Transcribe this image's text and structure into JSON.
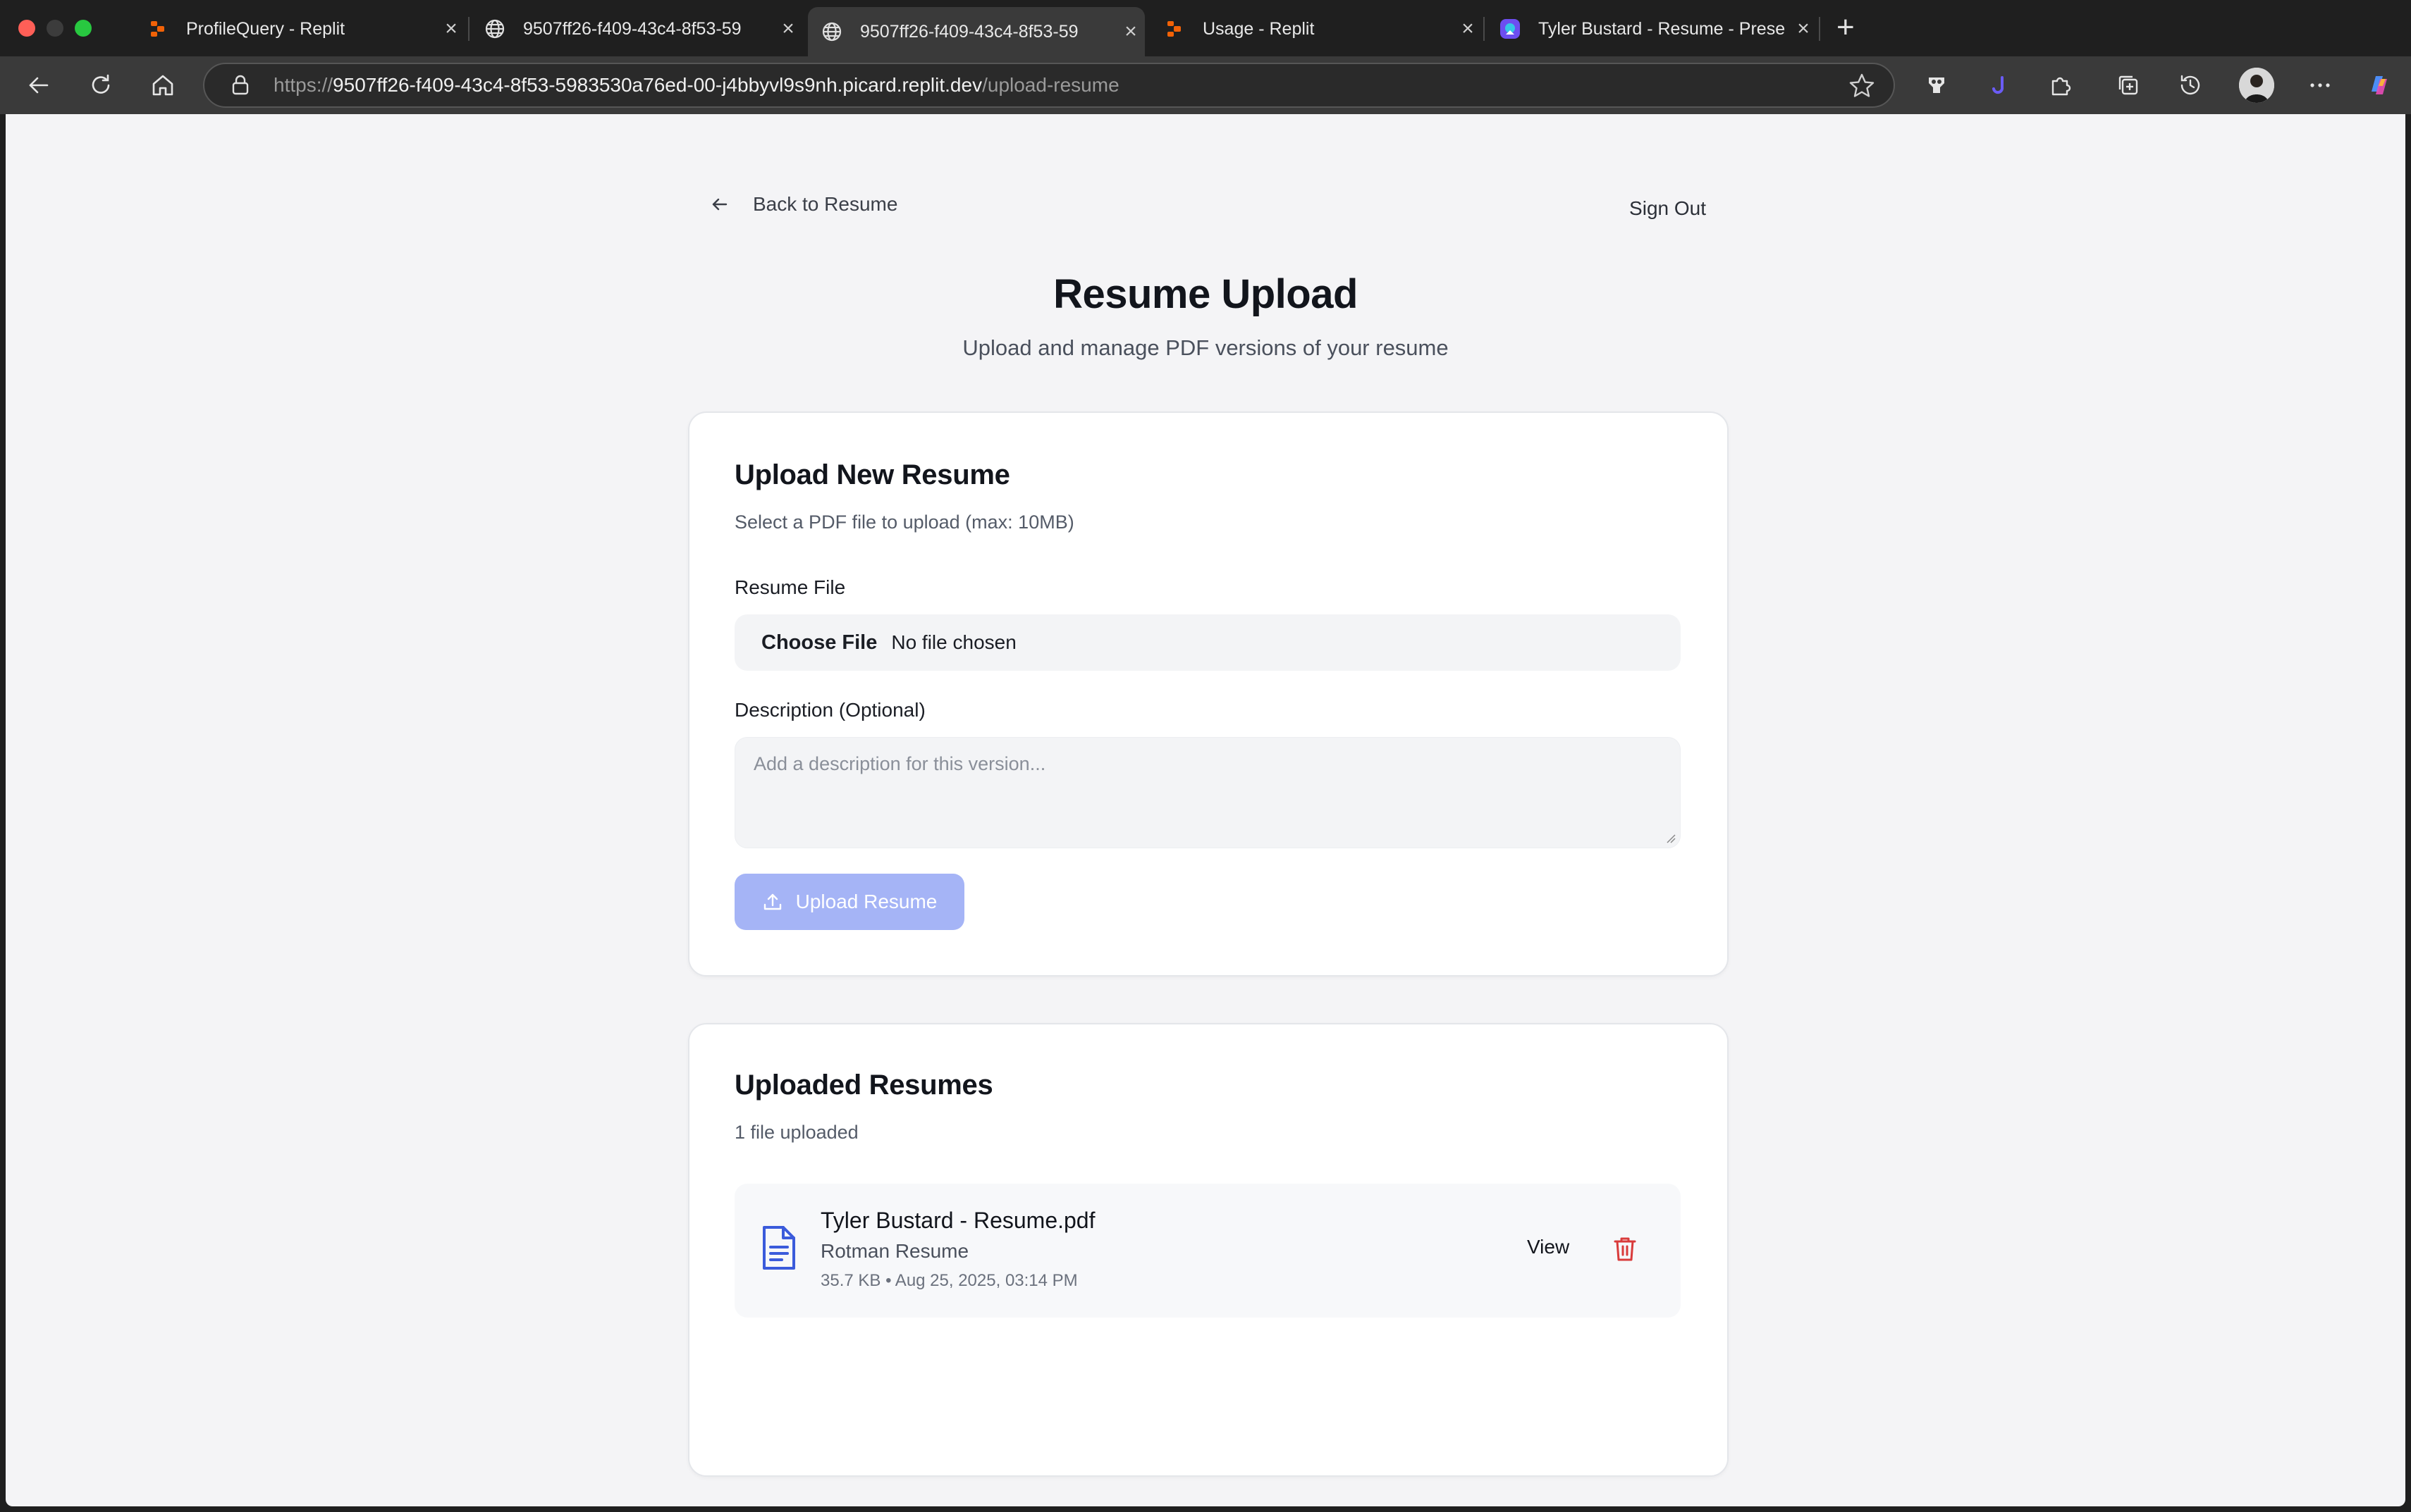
{
  "browser": {
    "tabs": [
      {
        "title": "ProfileQuery - Replit",
        "favicon": "replit-icon",
        "active": false
      },
      {
        "title": "9507ff26-f409-43c4-8f53-59",
        "favicon": "globe-icon",
        "active": false
      },
      {
        "title": "9507ff26-f409-43c4-8f53-59",
        "favicon": "globe-icon",
        "active": true
      },
      {
        "title": "Usage - Replit",
        "favicon": "replit-icon",
        "active": false
      },
      {
        "title": "Tyler Bustard - Resume - Prese",
        "favicon": "canva-icon",
        "active": false
      }
    ],
    "url_prefix": "https://",
    "url_host": "9507ff26-f409-43c4-8f53-5983530a76ed-00-j4bbyvl9s9nh.picard.replit.dev",
    "url_path": "/upload-resume"
  },
  "page": {
    "back_label": "Back to Resume",
    "signout_label": "Sign Out",
    "title": "Resume Upload",
    "subtitle": "Upload and manage PDF versions of your resume"
  },
  "upload_card": {
    "title": "Upload New Resume",
    "description": "Select a PDF file to upload (max: 10MB)",
    "file_label": "Resume File",
    "choose_file_label": "Choose File",
    "file_status": "No file chosen",
    "description_label": "Description (Optional)",
    "description_placeholder": "Add a description for this version...",
    "upload_button_label": "Upload Resume"
  },
  "list_card": {
    "title": "Uploaded Resumes",
    "count_text": "1 file uploaded",
    "files": [
      {
        "name": "Tyler Bustard - Resume.pdf",
        "description": "Rotman Resume",
        "meta": "35.7 KB • Aug 25, 2025, 03:14 PM",
        "view_label": "View"
      }
    ]
  },
  "colors": {
    "accent_disabled": "#a5b4f6",
    "doc_icon": "#3b5bdb",
    "delete": "#d93b3b"
  }
}
